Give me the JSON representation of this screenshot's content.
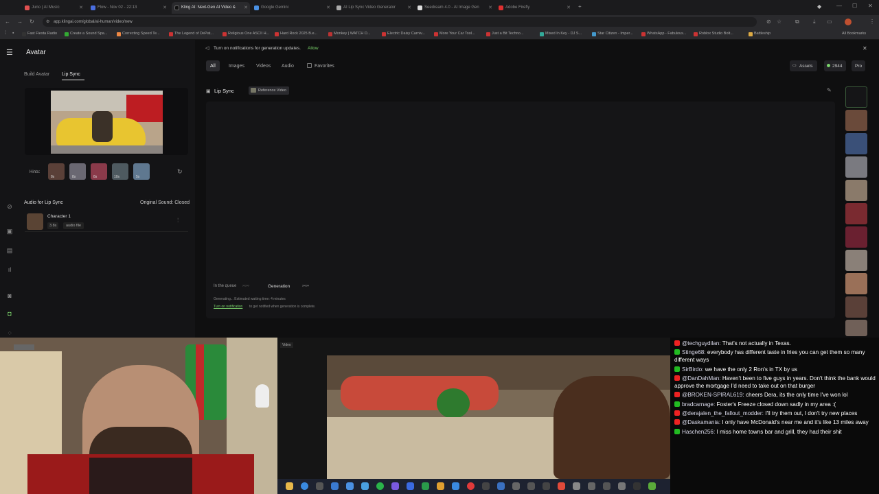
{
  "browser": {
    "tabs": [
      {
        "label": "Juno | AI Music",
        "color": "#e05050"
      },
      {
        "label": "Flow - Nov 02 - 22:13",
        "color": "#4a6ee0"
      },
      {
        "label": "Kling AI: Next-Gen AI Video &",
        "color": "#222222"
      },
      {
        "label": "Google Gemini",
        "color": "#4a90e2"
      },
      {
        "label": "AI Lip Sync Video Generator",
        "color": "#aaaaaa"
      },
      {
        "label": "Seedream 4.0 - AI Image Gen",
        "color": "#dddddd"
      },
      {
        "label": "Adobe Firefly",
        "color": "#e03030"
      }
    ],
    "url": "app.klingai.com/global/ai-human/video/new",
    "bookmarks": [
      "Fast Fiesta Radio",
      "Create a Sound Spa...",
      "Correcting Speed Te...",
      "The Legend of DePat...",
      "Religious One ASCII H...",
      "Hard Rock 2025 B.e...",
      "Monkey | WATCH D...",
      "Electric Daisy Carniv...",
      "More Your Car Tool...",
      "Just a Bit Techno...",
      "Mixed In Key - DJ S...",
      "Star Citizen - Imper...",
      "WhatsApp - Fabulous...",
      "Roblox Studio Bolt...",
      "Battleship"
    ],
    "all_bookmarks": "All Bookmarks"
  },
  "app": {
    "title": "Avatar",
    "tabs": [
      "Build Avatar",
      "Lip Sync"
    ],
    "hints_label": "Hints:",
    "hint_durations": [
      "8s",
      "8s",
      "8s",
      "10s",
      "5s"
    ],
    "audio_section_title": "Audio for Lip Sync",
    "original_sound": "Original Sound: Closed",
    "audio_item": {
      "name": "Character 1",
      "duration": "3.8s",
      "type": "audio file"
    },
    "notification": "Turn on notifications for generation updates.",
    "notification_action": "Allow",
    "filters": [
      "All",
      "Images",
      "Videos",
      "Audio",
      "Favorites"
    ],
    "assets_label": "Assets",
    "credits": "2944",
    "pro_label": "Pro",
    "result_title": "Lip Sync",
    "result_tag": "Reference Video",
    "queue_label": "In the queue",
    "generation_label": "Generation",
    "status_line": "Generating... Estimated waiting time: 4 minutes",
    "notify_link": "Turn on notification",
    "notify_rest": "to get notified when generation is complete.",
    "video_tag": "Video"
  },
  "chat": [
    {
      "src": "yt",
      "user": "@techguydilan:",
      "text": "That's not actually in Texas."
    },
    {
      "src": "tw",
      "user": "Stinge68:",
      "text": "everybody has different taste in fries you can get them so many different ways"
    },
    {
      "src": "tw",
      "user": "SirBirdo:",
      "text": "we have the only 2 Ron's in TX by us"
    },
    {
      "src": "yt",
      "user": "@DanDahMan:",
      "text": "Haven't been to five guys in years. Don't think the bank would approve the mortgage I'd need to take out on that burger"
    },
    {
      "src": "yt",
      "user": "@BROKEN-SPIRAL619:",
      "text": "cheers Dera, its the only time I've won lol"
    },
    {
      "src": "tw",
      "user": "bradcarnage:",
      "text": "Foster's Freeze closed down sadly in my area :("
    },
    {
      "src": "yt",
      "user": "@derajalen_the_fallout_modder:",
      "text": "I'll try them out, I don't try new places"
    },
    {
      "src": "yt",
      "user": "@Daskamania:",
      "text": "I only have McDonald's near me and it's like 13 miles away"
    },
    {
      "src": "tw",
      "user": "Haschen256:",
      "text": "I miss home towns bar and grill, they had their shit"
    }
  ],
  "colors": {
    "accent_green": "#7bd36b",
    "youtube": "#e22222",
    "twitch": "#22bb22"
  }
}
